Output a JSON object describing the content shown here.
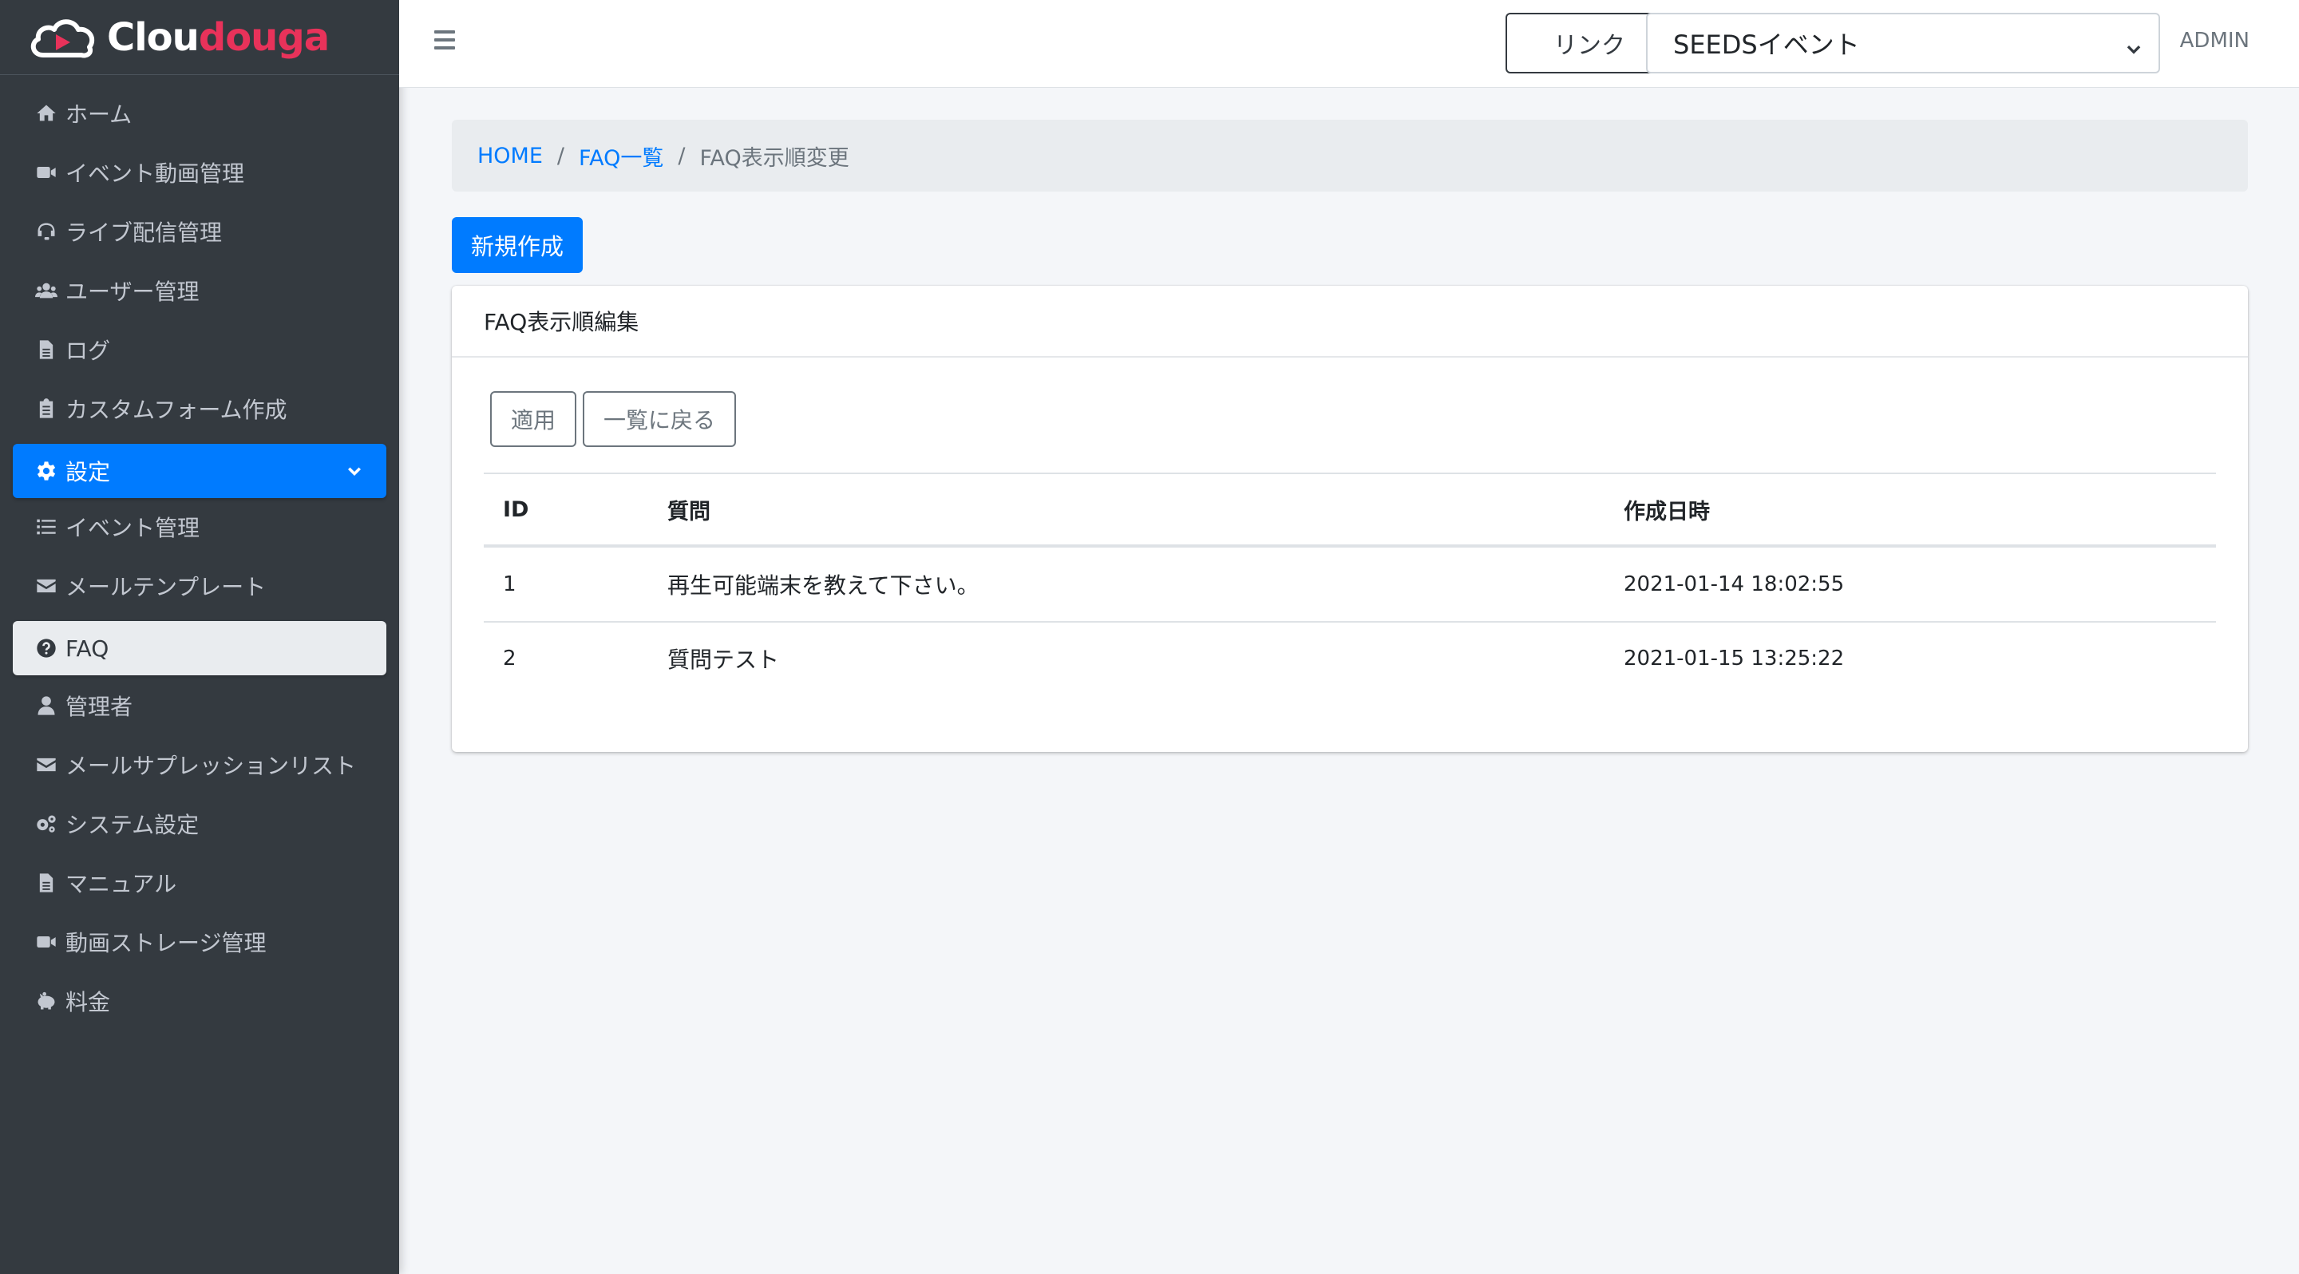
{
  "brand": {
    "name_part1": "Clou",
    "name_part2": "douga"
  },
  "sidebar": {
    "items": [
      {
        "label": "ホーム",
        "icon": "home-icon"
      },
      {
        "label": "イベント動画管理",
        "icon": "video-icon"
      },
      {
        "label": "ライブ配信管理",
        "icon": "headset-icon"
      },
      {
        "label": "ユーザー管理",
        "icon": "users-icon"
      },
      {
        "label": "ログ",
        "icon": "file-icon"
      },
      {
        "label": "カスタムフォーム作成",
        "icon": "clipboard-icon"
      },
      {
        "label": "設定",
        "icon": "gear-icon"
      },
      {
        "label": "イベント管理",
        "icon": "list-icon"
      },
      {
        "label": "メールテンプレート",
        "icon": "envelope-icon"
      },
      {
        "label": "FAQ",
        "icon": "question-circle-icon"
      },
      {
        "label": "管理者",
        "icon": "user-icon"
      },
      {
        "label": "メールサプレッションリスト",
        "icon": "envelope-icon"
      },
      {
        "label": "システム設定",
        "icon": "gears-icon"
      },
      {
        "label": "マニュアル",
        "icon": "file-icon"
      },
      {
        "label": "動画ストレージ管理",
        "icon": "video-icon"
      },
      {
        "label": "料金",
        "icon": "piggy-bank-icon"
      }
    ]
  },
  "topbar": {
    "link_label": "リンク",
    "event_selected": "SEEDSイベント",
    "user_label": "ADMIN"
  },
  "breadcrumb": {
    "home": "HOME",
    "faq_list": "FAQ一覧",
    "current": "FAQ表示順変更"
  },
  "actions": {
    "new_label": "新規作成"
  },
  "card": {
    "title": "FAQ表示順編集",
    "apply_label": "適用",
    "back_label": "一覧に戻る",
    "columns": {
      "id": "ID",
      "question": "質問",
      "created": "作成日時"
    },
    "rows": [
      {
        "id": "1",
        "question": "再生可能端末を教えて下さい。",
        "created": "2021-01-14 18:02:55"
      },
      {
        "id": "2",
        "question": "質問テスト",
        "created": "2021-01-15 13:25:22"
      }
    ]
  },
  "colors": {
    "primary": "#007bff",
    "sidebar": "#343a40",
    "brand_red": "#e8325a"
  }
}
